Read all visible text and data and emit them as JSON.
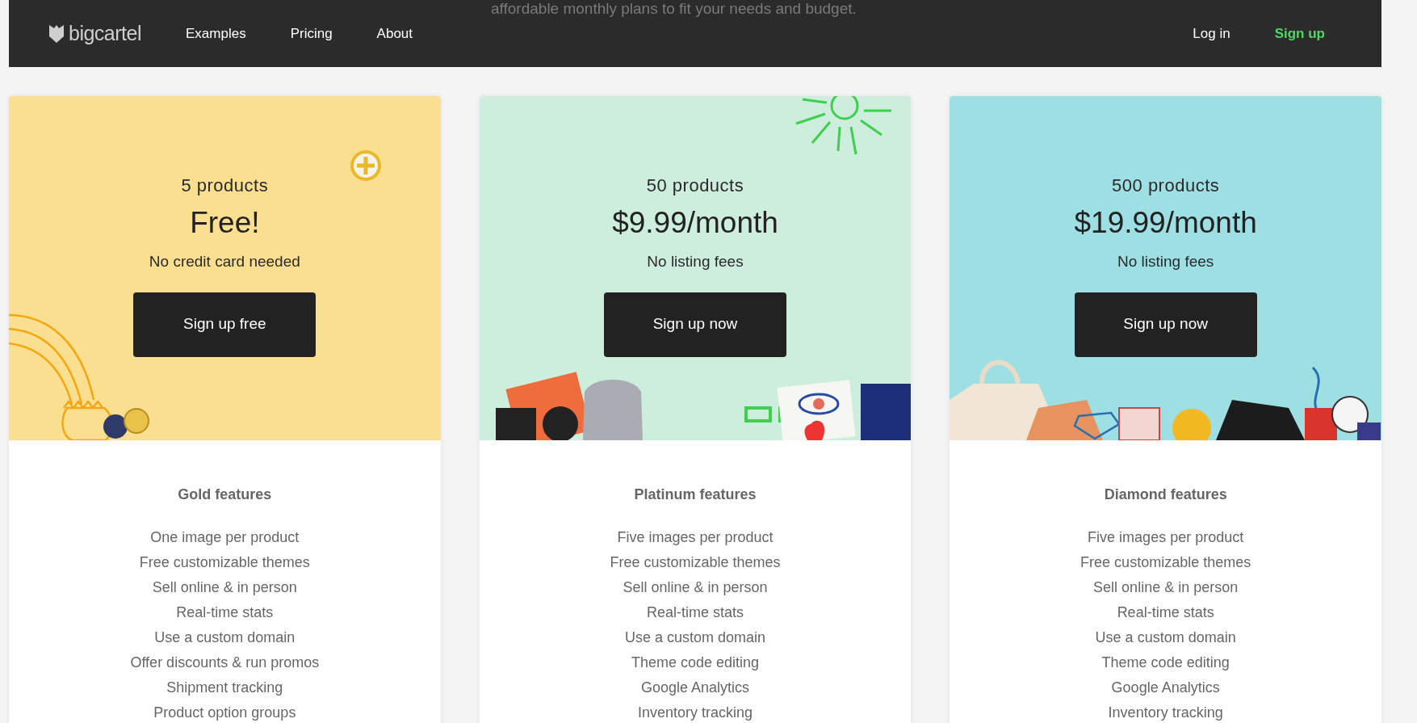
{
  "intro_text": "affordable monthly plans to fit your needs and budget.",
  "nav": {
    "logo": "bigcartel",
    "links": [
      "Examples",
      "Pricing",
      "About"
    ],
    "actions": [
      {
        "label": "Log in",
        "kind": "link"
      },
      {
        "label": "Sign up",
        "kind": "primary"
      }
    ]
  },
  "plans": [
    {
      "kind": "gold",
      "color": "#fadf90",
      "products": "5 products",
      "price": "Free!",
      "note": "No credit card needed",
      "button": "Sign up free",
      "features_title": "Gold features",
      "features": [
        "One image per product",
        "Free customizable themes",
        "Sell online & in person",
        "Real-time stats",
        "Use a custom domain",
        "Offer discounts & run promos",
        "Shipment tracking",
        "Product option groups"
      ]
    },
    {
      "kind": "platinum",
      "color": "#cdeedc",
      "products": "50 products",
      "price": "$9.99/month",
      "note": "No listing fees",
      "button": "Sign up now",
      "features_title": "Platinum features",
      "features": [
        "Five images per product",
        "Free customizable themes",
        "Sell online & in person",
        "Real-time stats",
        "Use a custom domain",
        "Theme code editing",
        "Google Analytics",
        "Inventory tracking"
      ]
    },
    {
      "kind": "diamond",
      "color": "#9ddfe3",
      "products": "500 products",
      "price": "$19.99/month",
      "note": "No listing fees",
      "button": "Sign up now",
      "features_title": "Diamond features",
      "features": [
        "Five images per product",
        "Free customizable themes",
        "Sell online & in person",
        "Real-time stats",
        "Use a custom domain",
        "Theme code editing",
        "Google Analytics",
        "Inventory tracking"
      ]
    }
  ]
}
